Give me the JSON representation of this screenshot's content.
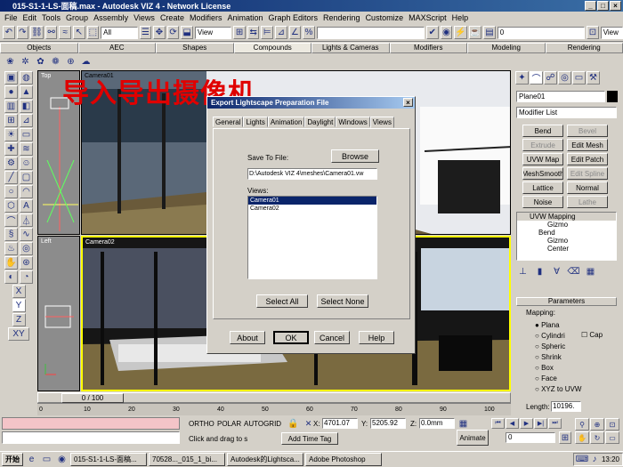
{
  "window": {
    "title": "015-S1-1-LS-面稿.max - Autodesk VIZ 4 - Network License"
  },
  "menu": [
    "File",
    "Edit",
    "Tools",
    "Group",
    "Assembly",
    "Views",
    "Create",
    "Modifiers",
    "Animation",
    "Graph Editors",
    "Rendering",
    "Customize",
    "MAXScript",
    "Help"
  ],
  "toolbar": {
    "selection_filter": "All",
    "ref_coord": "View",
    "named_sel": "",
    "frame_field": "0",
    "view_field": "View"
  },
  "tabs": [
    "Objects",
    "AEC",
    "Shapes",
    "Compounds",
    "Lights & Cameras",
    "Modifiers",
    "Modeling",
    "Rendering"
  ],
  "active_tab": "Compounds",
  "overlay_text": "导入导出摄像机",
  "viewports": {
    "top": "Top",
    "left": "Left",
    "camera01": "Camera01",
    "camera02": "Camera02"
  },
  "dialog": {
    "title": "Export Lightscape Preparation File",
    "tabs": [
      "General",
      "Lights",
      "Animation",
      "Daylight",
      "Windows",
      "Views"
    ],
    "save_label": "Save To File:",
    "browse": "Browse",
    "path": "D:\\Autodesk VIZ 4\\meshes\\Camera01.vw",
    "views_label": "Views:",
    "views": [
      "Camera01",
      "Camera02"
    ],
    "select_all": "Select All",
    "select_none": "Select None",
    "about": "About",
    "ok": "OK",
    "cancel": "Cancel",
    "help": "Help"
  },
  "command_panel": {
    "object_name": "Plane01",
    "modifier_list": "Modifier List",
    "modifier_buttons": [
      "Bend",
      "Bevel",
      "Extrude",
      "Edit Mesh",
      "UVW Map",
      "Edit Patch",
      "MeshSmooth",
      "Edit Spline",
      "Lattice",
      "Normal",
      "Noise",
      "Lathe"
    ],
    "stack": [
      "UVW Mapping",
      "Gizmo",
      "Bend",
      "Gizmo",
      "Center"
    ],
    "rollout_title": "Parameters",
    "mapping_label": "Mapping:",
    "mapping_options": [
      "Plana",
      "Cylindri",
      "Spheric",
      "Shrink",
      "Box",
      "Face",
      "XYZ to UVW"
    ],
    "cap_label": "Cap",
    "length_label": "Length:",
    "length_value": "10196."
  },
  "timeline": {
    "frame": "0 / 100",
    "ticks": [
      "0",
      "10",
      "20",
      "30",
      "40",
      "50",
      "60",
      "70",
      "80",
      "90",
      "100"
    ]
  },
  "status": {
    "ortho": "ORTHO",
    "polar": "POLAR",
    "autogrid": "AUTOGRID",
    "x_label": "X:",
    "x_value": "4701.07",
    "y_label": "Y:",
    "y_value": "5205.92",
    "z_label": "Z:",
    "z_value": "0.0mm",
    "prompt": "Click and drag to s",
    "add_time_tag": "Add Time Tag",
    "animate": "Animate",
    "frame_value": "0"
  },
  "taskbar": {
    "start": "开始",
    "tasks": [
      "015-S1-1-LS-面稿...",
      "70528..._015_1_bi...",
      "Autodesk的Lightsca...",
      "Adobe Photoshop"
    ],
    "clock": "13:20"
  }
}
